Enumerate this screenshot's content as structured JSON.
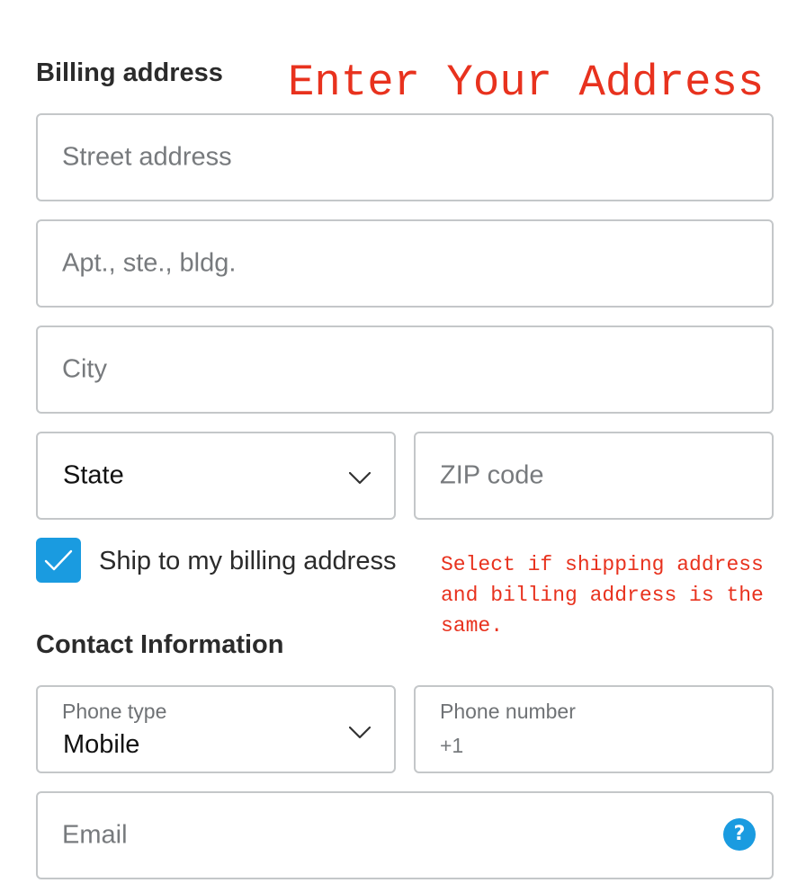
{
  "billing": {
    "title": "Billing address",
    "annotation": "Enter Your Address",
    "street_placeholder": "Street address",
    "apt_placeholder": "Apt., ste., bldg.",
    "city_placeholder": "City",
    "state_value": "State",
    "zip_placeholder": "ZIP code",
    "ship_checkbox_label": "Ship to my billing address",
    "ship_checkbox_checked": true,
    "ship_annotation": "Select if shipping address and billing address is the same."
  },
  "contact": {
    "title": "Contact Information",
    "phone_type_label": "Phone type",
    "phone_type_value": "Mobile",
    "phone_number_label": "Phone number",
    "phone_prefix": "+1",
    "email_placeholder": "Email",
    "help_symbol": "?"
  },
  "colors": {
    "accent": "#1a9be0",
    "annotation": "#e8321e",
    "border": "#c4c7c9",
    "placeholder": "#777a7d"
  },
  "icons": {
    "dropdown": "chevron-down-icon",
    "checkbox": "checkmark-icon",
    "help": "question-mark-icon"
  }
}
